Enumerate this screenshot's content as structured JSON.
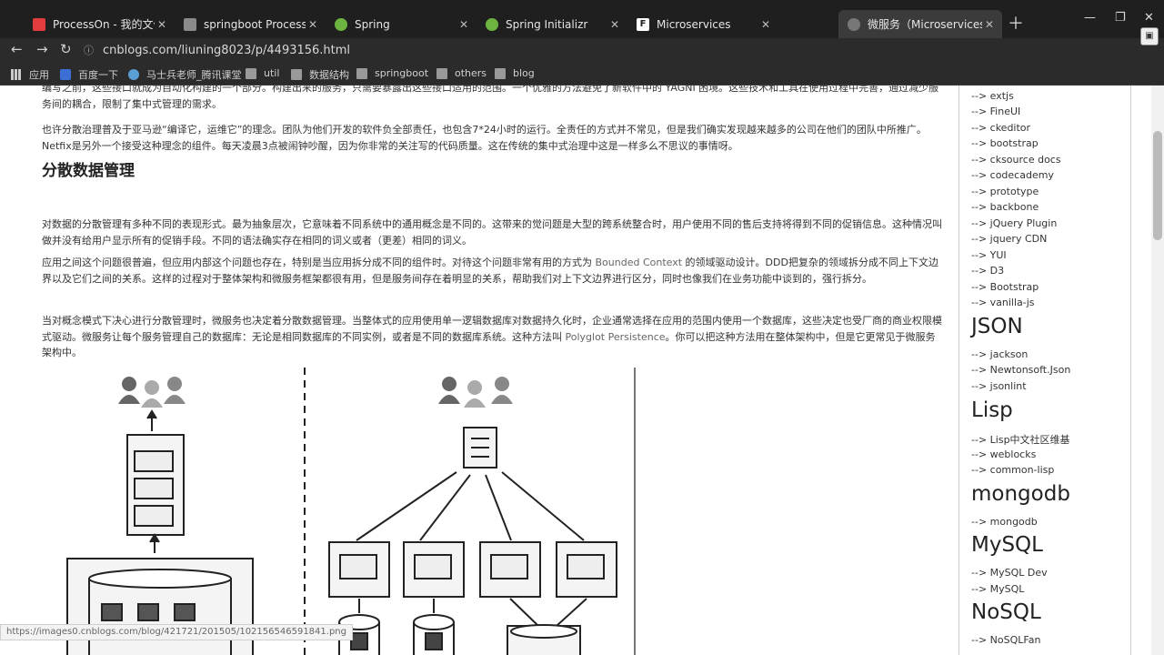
{
  "tabs": [
    {
      "title": "ProcessOn - 我的文件",
      "color": "#e23d3d"
    },
    {
      "title": "springboot ProcessOn Mi",
      "color": "#8a8a8a"
    },
    {
      "title": "Spring",
      "color": "#6db33f"
    },
    {
      "title": "Spring Initializr",
      "color": "#6db33f"
    },
    {
      "title": "Microservices",
      "color": "#222222"
    },
    {
      "title": "微服务（Microservices）",
      "color": "#777777"
    }
  ],
  "url": "cnblogs.com/liuning8023/p/4493156.html",
  "bookmarks": [
    "应用",
    "百度一下",
    "马士兵老师_腾讯课堂",
    "util",
    "数据结构",
    "springboot",
    "others",
    "blog"
  ],
  "article": {
    "p0": "编写之前，这些接口就成为自动化构建的一个部分。构建出来的服务，只需要暴露出这些接口适用的范围。一个优雅的方法避免了新软件中的 YAGNI 困境。这些技术和工具在使用过程中完善，通过减少服务间的耦合，限制了集中式管理的需求。",
    "p1": "也许分散治理普及于亚马逊“编译它，运维它”的理念。团队为他们开发的软件负全部责任，也包含7*24小时的运行。全责任的方式并不常见，但是我们确实发现越来越多的公司在他们的团队中所推广。Netfix是另外一个接受这种理念的组件。每天凌晨3点被闹钟吵醒，因为你非常的关注写的代码质量。这在传统的集中式治理中这是一样多么不思议的事情呀。",
    "heading": "分散数据管理",
    "p2": "对数据的分散管理有多种不同的表现形式。最为抽象层次，它意味着不同系统中的通用概念是不同的。这带来的觉问题是大型的跨系统整合时，用户使用不同的售后支持将得到不同的促销信息。这种情况叫做并没有给用户显示所有的促销手段。不同的语法确实存在相同的词义或者（更差）相同的词义。",
    "p3_a": "应用之间这个问题很普遍，但应用内部这个问题也存在，特别是当应用拆分成不同的组件时。对待这个问题非常有用的方式为 ",
    "p3_term": "Bounded Context",
    "p3_b": " 的领域驱动设计。DDD把复杂的领域拆分成不同上下文边界以及它们之间的关系。这样的过程对于整体架构和微服务框架都很有用，但是服务间存在着明显的关系，帮助我们对上下文边界进行区分，同时也像我们在业务功能中谈到的，强行拆分。",
    "p4_a": "当对概念模式下决心进行分散管理时，微服务也决定着分散数据管理。当整体式的应用使用单一逻辑数据库对数据持久化时，企业通常选择在应用的范围内使用一个数据库，这些决定也受厂商的商业权限模式驱动。微服务让每个服务管理自己的数据库：无论是相同数据库的不同实例，或者是不同的数据库系统。这种方法叫 ",
    "p4_term": "Polyglot Persistence",
    "p4_b": "。你可以把这种方法用在整体架构中，但是它更常见于微服务架构中。"
  },
  "sidebar": {
    "links_top": [
      "--> extjs",
      "--> FineUI",
      "--> ckeditor",
      "--> bootstrap",
      "--> cksource docs",
      "--> codecademy",
      "--> prototype",
      "--> backbone",
      "--> jQuery Plugin",
      "--> jquery CDN",
      "--> YUI",
      "--> D3",
      "--> Bootstrap",
      "--> vanilla-js"
    ],
    "cat_json": "JSON",
    "links_json": [
      "--> jackson",
      "--> Newtonsoft.Json",
      "--> jsonlint"
    ],
    "cat_lisp": "Lisp",
    "links_lisp": [
      "--> Lisp中文社区维基",
      "--> weblocks",
      "--> common-lisp"
    ],
    "cat_mongodb": "mongodb",
    "links_mongodb": [
      "--> mongodb"
    ],
    "cat_mysql": "MySQL",
    "links_mysql": [
      "--> MySQL Dev",
      "--> MySQL"
    ],
    "cat_nosql": "NoSQL",
    "links_nosql": [
      "--> NoSQLFan"
    ]
  },
  "status_url": "https://images0.cnblogs.com/blog/421721/201505/102156546591841.png"
}
